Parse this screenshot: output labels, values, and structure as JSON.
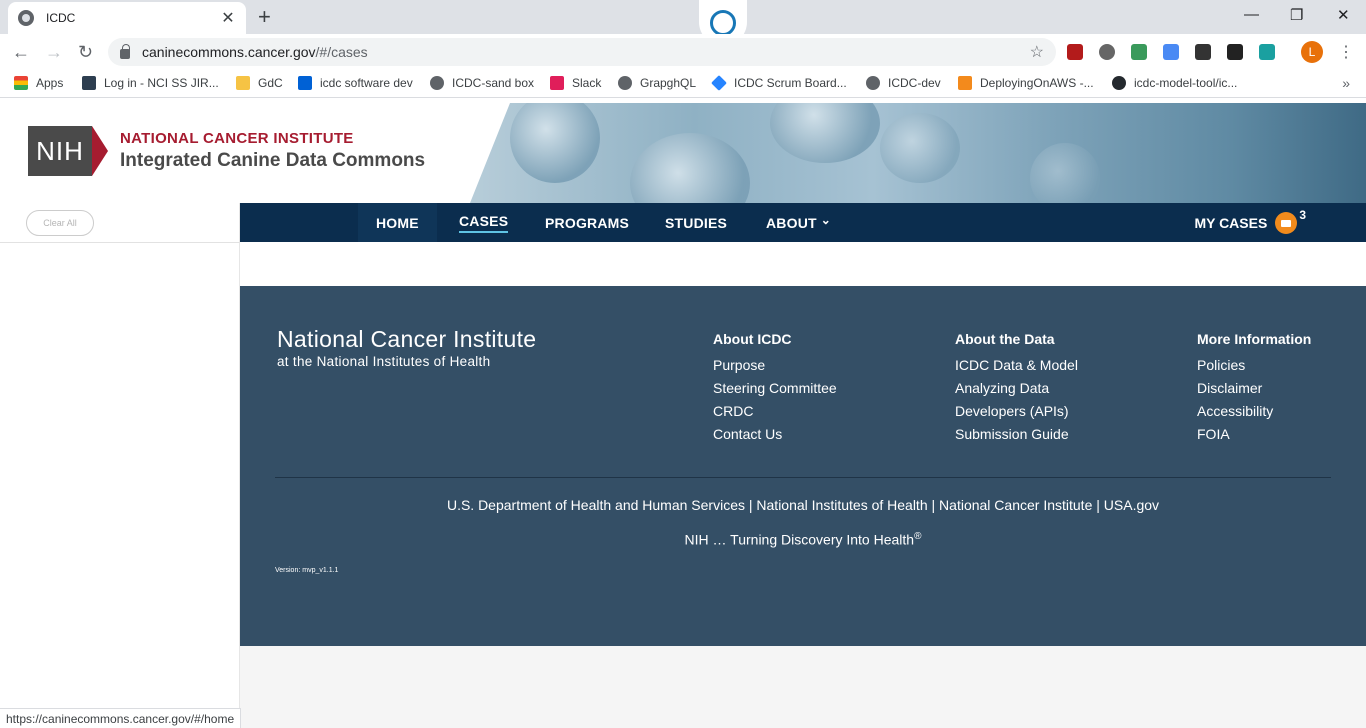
{
  "browser": {
    "tab_title": "ICDC",
    "url_host": "caninecommons.cancer.gov",
    "url_path": "/#/cases",
    "avatar_letter": "L",
    "status_url": "https://caninecommons.cancer.gov/#/home",
    "bookmarks": [
      {
        "label": "Apps",
        "icon": "apps-grid-icon",
        "color": "#1a73e8"
      },
      {
        "label": "Log in - NCI SS JIR...",
        "icon": "jira-icon",
        "color": "#2d3e50"
      },
      {
        "label": "GdC",
        "icon": "folder-icon",
        "color": "#f6c344"
      },
      {
        "label": "icdc software dev",
        "icon": "box-icon",
        "color": "#0061d5"
      },
      {
        "label": "ICDC-sand box",
        "icon": "globe-icon",
        "color": "#5f6368"
      },
      {
        "label": "Slack",
        "icon": "slack-icon",
        "color": "#e01e5a"
      },
      {
        "label": "GrapghQL",
        "icon": "globe-icon",
        "color": "#5f6368"
      },
      {
        "label": "ICDC Scrum Board...",
        "icon": "jira-diamond-icon",
        "color": "#2684ff"
      },
      {
        "label": "ICDC-dev",
        "icon": "globe-icon",
        "color": "#5f6368"
      },
      {
        "label": "DeployingOnAWS -...",
        "icon": "aws-icon",
        "color": "#f38a1c"
      },
      {
        "label": "icdc-model-tool/ic...",
        "icon": "github-icon",
        "color": "#24292e"
      }
    ]
  },
  "header": {
    "logo_text": "NIH",
    "institute": "NATIONAL CANCER INSTITUTE",
    "site_name": "Integrated Canine Data Commons"
  },
  "sidebar": {
    "clear_all": "Clear All"
  },
  "nav": {
    "items": [
      "HOME",
      "CASES",
      "PROGRAMS",
      "STUDIES",
      "ABOUT"
    ],
    "about_caret": "⌄",
    "my_cases": "MY CASES",
    "my_cases_count": "3"
  },
  "footer": {
    "title": "National Cancer Institute",
    "subtitle": "at the National Institutes of Health",
    "columns": [
      {
        "heading": "About ICDC",
        "links": [
          "Purpose",
          "Steering Committee",
          "CRDC",
          "Contact Us"
        ]
      },
      {
        "heading": "About the Data",
        "links": [
          "ICDC Data & Model",
          "Analyzing Data",
          "Developers (APIs)",
          "Submission Guide"
        ]
      },
      {
        "heading": "More Information",
        "links": [
          "Policies",
          "Disclaimer",
          "Accessibility",
          "FOIA"
        ]
      }
    ],
    "gov_links": [
      "U.S. Department of Health and Human Services",
      "National Institutes of Health",
      "National Cancer Institute",
      "USA.gov"
    ],
    "tagline": "NIH … Turning Discovery Into Health",
    "tagline_mark": "®",
    "version": "Version: mvp_v1.1.1"
  }
}
